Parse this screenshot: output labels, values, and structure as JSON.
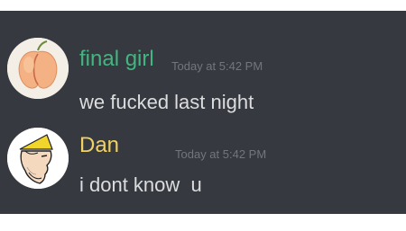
{
  "messages": [
    {
      "username": "final girl",
      "username_color": "#43b581",
      "timestamp": "Today at 5:42 PM",
      "content": "we fucked last night",
      "avatar_icon": "peach-avatar"
    },
    {
      "username": "Dan",
      "username_color": "#f0d264",
      "timestamp": "Today at 5:42 PM",
      "content": "i dont know  u",
      "avatar_icon": "chad-yellow-hat-avatar"
    }
  ]
}
